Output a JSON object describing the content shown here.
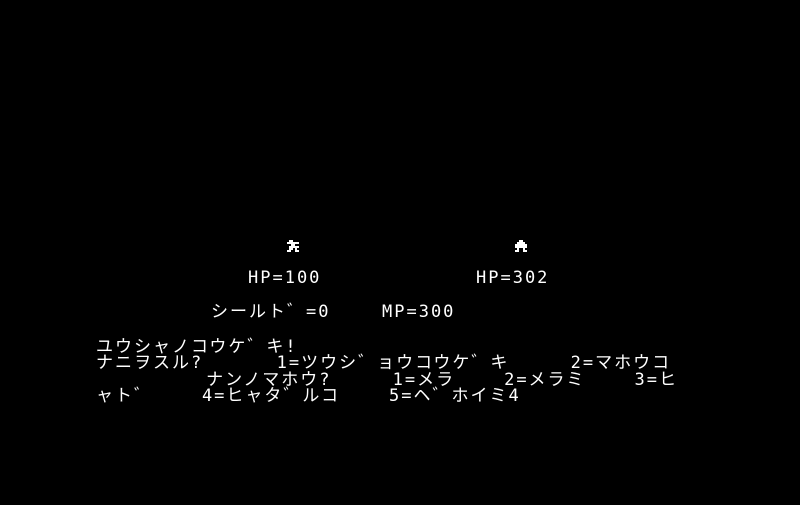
{
  "colors": {
    "background": "#000000",
    "text": "#ffffff"
  },
  "battle": {
    "hero": {
      "sprite": "hero-sprite-icon",
      "hp_text": "HP=100",
      "shield_text": "シールト゛=0",
      "mp_text": "MP=300"
    },
    "enemy": {
      "sprite": "enemy-sprite-icon",
      "hp_text": "HP=302"
    }
  },
  "message": {
    "line1": "ユウシャノコウケ゛キ!",
    "line2": "ナニヲスル?      1=ツウシ゛ョウコウケ゛キ     2=マホウコ",
    "line3": "         ナンノマホウ?     1=メラ    2=メラミ    3=ヒ",
    "line4": "ャト゛    4=ヒャタ゛ルコ    5=ヘ゛ホイミ4"
  }
}
